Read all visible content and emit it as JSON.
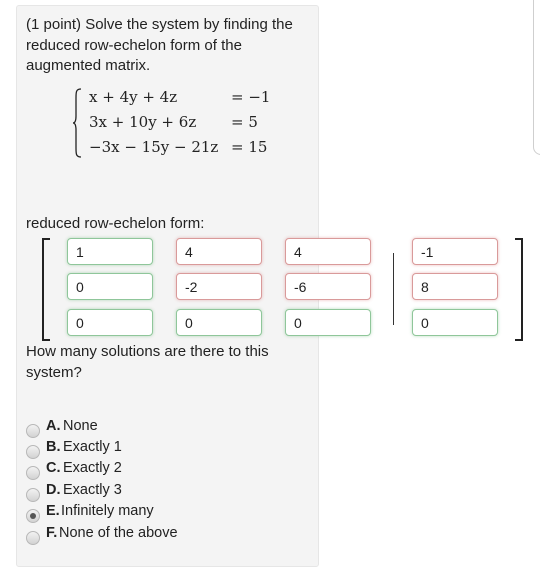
{
  "problem": {
    "intro": "(1 point) Solve the system by finding the reduced row-echelon form of the augmented matrix.",
    "equations": [
      {
        "lhs": "x + 4y + 4z",
        "rhs": "= −1"
      },
      {
        "lhs": "3x + 10y + 6z",
        "rhs": "= 5"
      },
      {
        "lhs": "−3x − 15y − 21z",
        "rhs": "= 15"
      }
    ]
  },
  "rref": {
    "label": "reduced row-echelon form:",
    "rows": [
      [
        {
          "value": "1",
          "status": "correct"
        },
        {
          "value": "4",
          "status": "incorrect"
        },
        {
          "value": "4",
          "status": "incorrect"
        },
        {
          "value": "-1",
          "status": "incorrect"
        }
      ],
      [
        {
          "value": "0",
          "status": "correct"
        },
        {
          "value": "-2",
          "status": "incorrect"
        },
        {
          "value": "-6",
          "status": "incorrect"
        },
        {
          "value": "8",
          "status": "incorrect"
        }
      ],
      [
        {
          "value": "0",
          "status": "correct"
        },
        {
          "value": "0",
          "status": "correct"
        },
        {
          "value": "0",
          "status": "correct"
        },
        {
          "value": "0",
          "status": "correct"
        }
      ]
    ],
    "colors": {
      "correct": "#8fc69a",
      "incorrect": "#d99a9a"
    }
  },
  "question": {
    "text": "How many solutions are there to this system?",
    "options": [
      {
        "letter": "A.",
        "label": "None",
        "selected": false
      },
      {
        "letter": "B.",
        "label": "Exactly 1",
        "selected": false
      },
      {
        "letter": "C.",
        "label": "Exactly 2",
        "selected": false
      },
      {
        "letter": "D.",
        "label": "Exactly 3",
        "selected": false
      },
      {
        "letter": "E.",
        "label": "Infinitely many",
        "selected": true
      },
      {
        "letter": "F.",
        "label": "None of the above",
        "selected": false
      }
    ]
  }
}
